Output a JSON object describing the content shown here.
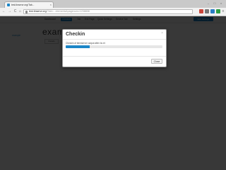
{
  "browser": {
    "tab_title": "test.tinservr.org/Tab...",
    "tab_close": "×",
    "url_host": "test.tinservr.org",
    "url_path": "/?tab=...elements&pagenum=1238808",
    "back": "←",
    "forward": "→",
    "reload": "C",
    "home": "⌂"
  },
  "page": {
    "nav_items": [
      "Dashboard",
      "Checkin",
      "Tab",
      "Exit Page",
      "Quick Settings",
      "Service Tab",
      "Settings"
    ],
    "nav_right_button": "Edit Settings",
    "side_link": "example",
    "heading": "exam",
    "sub_tab": "Details"
  },
  "modal": {
    "title": "Checkin",
    "close_glyph": "×",
    "message": "Checkin of timeserver output after 4s et",
    "progress_fraction": 0.25,
    "close_button": "Close"
  },
  "colors": {
    "accent": "#1c86c7"
  }
}
